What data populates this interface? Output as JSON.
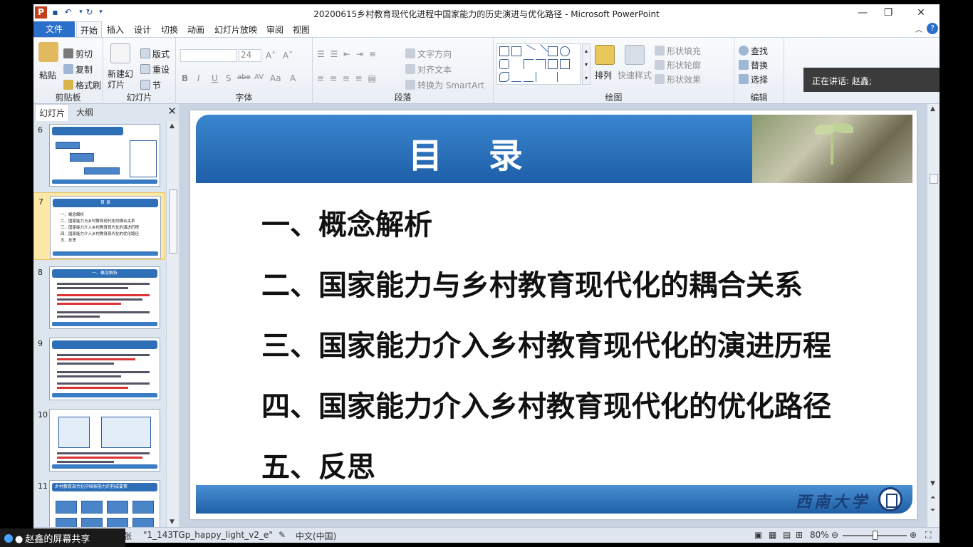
{
  "window": {
    "title": "20200615乡村教育现代化进程中国家能力的历史演进与优化路径 - Microsoft PowerPoint",
    "controls": [
      "—",
      "❐",
      "✕"
    ]
  },
  "menu": {
    "file": "文件",
    "tabs": [
      "开始",
      "插入",
      "设计",
      "切换",
      "动画",
      "幻灯片放映",
      "审阅",
      "视图"
    ],
    "active": "开始"
  },
  "ribbon": {
    "clipboard": {
      "label": "剪贴板",
      "paste": "粘贴",
      "cut": "剪切",
      "copy": "复制",
      "format_painter": "格式刷"
    },
    "slides": {
      "label": "幻灯片",
      "new_slide": "新建幻灯片",
      "layout": "版式",
      "reset": "重设",
      "section": "节"
    },
    "font": {
      "label": "字体",
      "size": "24",
      "bold": "B",
      "italic": "I",
      "underline": "U",
      "shadow": "S",
      "strike": "abe",
      "spacing": "AV",
      "case": "Aa",
      "color": "A"
    },
    "paragraph": {
      "label": "段落",
      "text_direction": "文字方向",
      "align_text": "对齐文本",
      "smartart": "转换为 SmartArt"
    },
    "drawing": {
      "label": "绘图",
      "arrange": "排列",
      "quick_styles": "快速样式",
      "shape_fill": "形状填充",
      "shape_outline": "形状轮廓",
      "shape_effects": "形状效果"
    },
    "editing": {
      "label": "编辑",
      "find": "查找",
      "replace": "替换",
      "select": "选择"
    }
  },
  "speaking_banner": "正在讲话: 赵鑫;",
  "panel": {
    "tabs": [
      "幻灯片",
      "大纲"
    ],
    "active_tab": "幻灯片",
    "thumbnails": [
      {
        "num": "6"
      },
      {
        "num": "7",
        "title": "目  录",
        "items": [
          "一、概念解析",
          "二、国家能力与乡村教育现代化的耦合关系",
          "三、国家能力介入乡村教育现代化的演进历程",
          "四、国家能力介入乡村教育现代化的优化路径",
          "五、反思"
        ],
        "selected": true
      },
      {
        "num": "8",
        "title": "一、概念解析"
      },
      {
        "num": "9"
      },
      {
        "num": "10"
      },
      {
        "num": "11",
        "title": "乡村教育现代化中国家能力的构成要素"
      }
    ]
  },
  "slide": {
    "title": "目 录",
    "items": [
      "一、概念解析",
      "二、国家能力与乡村教育现代化的耦合关系",
      "三、国家能力介入乡村教育现代化的演进历程",
      "四、国家能力介入乡村教育现代化的优化路径",
      "五、反思"
    ],
    "footer_logo": "西南大学"
  },
  "status": {
    "slide_info": "张",
    "theme": "\"1_143TGp_happy_light_v2_e\"",
    "language": "中文(中国)",
    "zoom": "80%",
    "zoom_fraction": 0.5
  },
  "screen_share": "赵鑫的屏幕共享"
}
